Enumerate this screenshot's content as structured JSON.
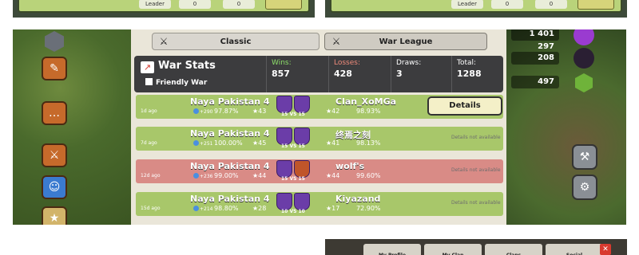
{
  "top_thumbs": [
    {
      "label_a": "Leader",
      "val1": "0",
      "val2": "0"
    },
    {
      "label_a": "Leader",
      "val1": "0",
      "val2": "0"
    }
  ],
  "tabs": {
    "classic": "Classic",
    "war_league": "War League"
  },
  "stats": {
    "title": "War Stats",
    "friendly_war": "Friendly War",
    "wins_label": "Wins:",
    "wins": "857",
    "losses_label": "Losses:",
    "losses": "428",
    "draws_label": "Draws:",
    "draws": "3",
    "total_label": "Total:",
    "total": "1288"
  },
  "resources": {
    "top": "1 401 297",
    "mid": "208",
    "gems": "497"
  },
  "wars": [
    {
      "ago": "1d ago",
      "clan": "Naya Pakistan 4",
      "trophies": "+290",
      "pct1": "97.87%",
      "stars1": "43",
      "vs": "15 VS 15",
      "opponent": "Clan_XoMGa",
      "stars2": "42",
      "pct2": "98.93%",
      "result": "win",
      "action": "Details"
    },
    {
      "ago": "7d ago",
      "clan": "Naya Pakistan 4",
      "trophies": "+251",
      "pct1": "100.00%",
      "stars1": "45",
      "vs": "15 VS 15",
      "opponent": "终焉之刻",
      "stars2": "41",
      "pct2": "98.13%",
      "result": "win",
      "action": "Details not available"
    },
    {
      "ago": "12d ago",
      "clan": "Naya Pakistan 4",
      "trophies": "+236",
      "pct1": "99.00%",
      "stars1": "44",
      "vs": "15 VS 15",
      "opponent": "wolf's",
      "stars2": "44",
      "pct2": "99.60%",
      "result": "loss",
      "action": "Details not available"
    },
    {
      "ago": "15d ago",
      "clan": "Naya Pakistan 4",
      "trophies": "+214",
      "pct1": "98.80%",
      "stars1": "28",
      "vs": "10 VS 10",
      "opponent": "Kiyazand",
      "stars2": "17",
      "pct2": "72.90%",
      "result": "win",
      "action": "Details not available"
    }
  ],
  "bottom_tabs": [
    "My Profile",
    "My Clan",
    "Clans",
    "Social"
  ]
}
